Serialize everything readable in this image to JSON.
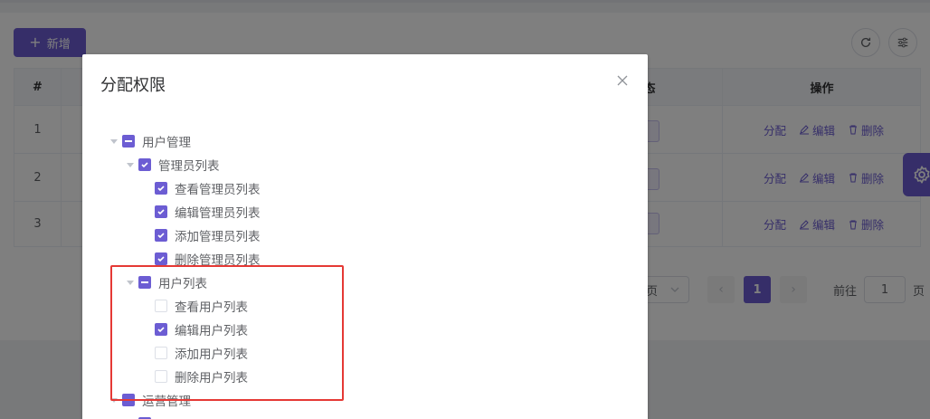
{
  "background": {
    "toolbar": {
      "add_label": "新增",
      "refresh_icon": "refresh-icon",
      "columns_icon": "sliders-icon"
    },
    "table": {
      "headers": {
        "index": "#",
        "mid": "态",
        "actions": "操作"
      },
      "rows": [
        {
          "index": "1",
          "assign": "分配",
          "edit": "编辑",
          "delete": "删除"
        },
        {
          "index": "2",
          "assign": "分配",
          "edit": "编辑",
          "delete": "删除"
        },
        {
          "index": "3",
          "assign": "分配",
          "edit": "编辑",
          "delete": "删除"
        }
      ]
    },
    "pagination": {
      "page_size_suffix": "页",
      "current_page": "1",
      "goto_label": "前往",
      "goto_value": "1",
      "goto_suffix": "页"
    }
  },
  "dialog": {
    "title": "分配权限",
    "close_icon": "close-icon",
    "tree": [
      {
        "label": "用户管理",
        "level": 0,
        "state": "half",
        "expanded": true
      },
      {
        "label": "管理员列表",
        "level": 1,
        "state": "checked",
        "expanded": true
      },
      {
        "label": "查看管理员列表",
        "level": 2,
        "state": "checked"
      },
      {
        "label": "编辑管理员列表",
        "level": 2,
        "state": "checked"
      },
      {
        "label": "添加管理员列表",
        "level": 2,
        "state": "checked"
      },
      {
        "label": "删除管理员列表",
        "level": 2,
        "state": "checked"
      },
      {
        "label": "用户列表",
        "level": 1,
        "state": "half",
        "expanded": true
      },
      {
        "label": "查看用户列表",
        "level": 2,
        "state": "unchecked"
      },
      {
        "label": "编辑用户列表",
        "level": 2,
        "state": "checked"
      },
      {
        "label": "添加用户列表",
        "level": 2,
        "state": "unchecked"
      },
      {
        "label": "删除用户列表",
        "level": 2,
        "state": "unchecked"
      },
      {
        "label": "运营管理",
        "level": 0,
        "state": "half",
        "expanded": true
      },
      {
        "label": "",
        "level": 1,
        "state": "checked",
        "expanded": true
      }
    ]
  },
  "colors": {
    "primary": "#6c5dd3",
    "highlight": "#e53935"
  }
}
